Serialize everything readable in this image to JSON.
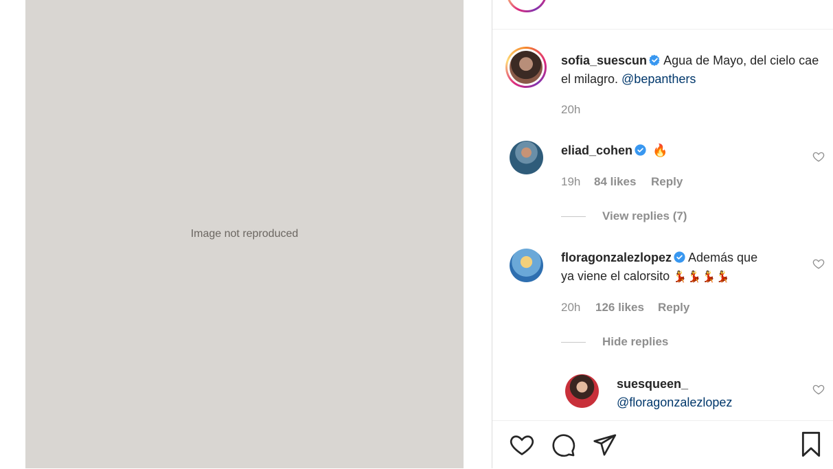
{
  "photo": {
    "note": "Image not reproduced"
  },
  "post": {
    "author": "sofia_suescun",
    "caption_text": "Agua de Mayo, del cielo cae el milagro. ",
    "caption_mention": "@bepanthers",
    "time": "20h"
  },
  "comments": [
    {
      "username": "eliad_cohen",
      "verified": true,
      "text": "🔥",
      "time": "19h",
      "likes": "84 likes",
      "reply": "Reply",
      "replies_toggle": "View replies (7)"
    },
    {
      "username": "floragonzalezlopez",
      "verified": true,
      "text_line1": "Además que",
      "text_line2": "ya viene el calorsito",
      "emoji": "💃💃💃💃",
      "time": "20h",
      "likes": "126 likes",
      "reply": "Reply",
      "replies_toggle": "Hide replies"
    }
  ],
  "reply": {
    "username": "suesqueen_",
    "mention": "@floragonzalezlopez"
  },
  "colors": {
    "verified_blue": "#3897f0",
    "link": "#00376b",
    "muted": "#8e8e8e"
  }
}
